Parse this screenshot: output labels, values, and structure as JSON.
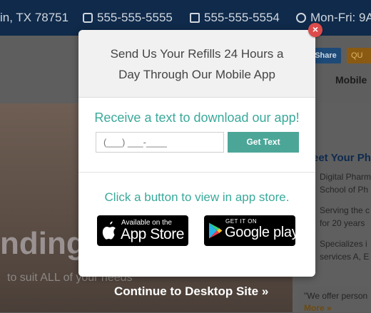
{
  "topbar": {
    "address": "in, TX 78751",
    "phone1": "555-555-5555",
    "phone2": "555-555-5554",
    "hours": "Mon-Fri: 9A"
  },
  "nav": {
    "share_label": "Share",
    "qu_label": "QU",
    "mobile_label": "Mobile",
    "dash": "-"
  },
  "hero": {
    "big_text": "nding",
    "sub_text": "to suit ALL of your needs"
  },
  "sidebar": {
    "title": "eet Your Ph",
    "lines": [
      "Digital Pharm",
      "School of Ph",
      "Serving the c",
      "for 20 years",
      "Specializes i",
      "services A, E"
    ],
    "quote": "\"We offer person",
    "more": "More »"
  },
  "continue_label": "Continue to Desktop Site »",
  "modal": {
    "title_line1": "Send Us Your Refills 24 Hours a",
    "title_line2": "Day Through Our Mobile App",
    "sms_heading": "Receive a text to download our app!",
    "phone_placeholder": "(___) ___-____",
    "get_text_label": "Get Text",
    "store_heading": "Click a button to view in app store.",
    "appstore_small": "Available on the",
    "appstore_big": "App Store",
    "googleplay_small": "GET IT ON",
    "googleplay_big": "Google play"
  },
  "close_label": "×",
  "colors": {
    "teal": "#3aa99a",
    "button_teal": "#4ca698",
    "close_red": "#dd4b4b",
    "topbar_navy": "#0f2a4a"
  },
  "icons": {
    "phone": "phone-icon",
    "fax": "fax-icon",
    "clock": "clock-icon",
    "apple": "apple-icon",
    "play": "google-play-icon",
    "close": "close-icon"
  }
}
